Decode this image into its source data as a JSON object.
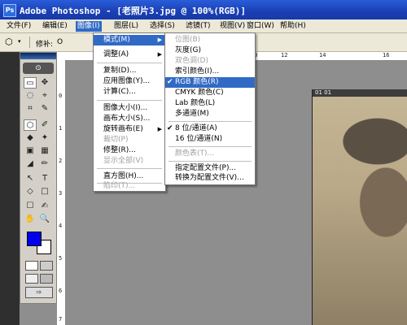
{
  "window": {
    "title": "Adobe Photoshop - [老照片3.jpg @ 100%(RGB)]",
    "logo": "Ps"
  },
  "menubar": {
    "items": [
      "文件(F)",
      "编辑(E)",
      "图像(I)",
      "图层(L)",
      "选择(S)",
      "滤镜(T)",
      "视图(V)",
      "窗口(W)",
      "帮助(H)"
    ]
  },
  "options": {
    "feather_label": "修补:",
    "radio_label": "O"
  },
  "ruler": {
    "h_labels": [
      "10",
      "12",
      "14",
      "16"
    ],
    "v_labels": [
      "0",
      "1",
      "2",
      "3",
      "4",
      "5",
      "6",
      "7"
    ]
  },
  "document": {
    "tab": "01 01"
  },
  "image_menu": {
    "items": [
      {
        "label": "模式(M)",
        "state": "highlight",
        "submenu": true
      },
      {
        "label": "调整(A)",
        "state": "normal",
        "submenu": true
      },
      {
        "label": "复制(D)...",
        "state": "normal"
      },
      {
        "label": "应用图像(Y)...",
        "state": "normal"
      },
      {
        "label": "计算(C)...",
        "state": "normal"
      },
      {
        "label": "图像大小(I)...",
        "state": "normal"
      },
      {
        "label": "画布大小(S)...",
        "state": "normal"
      },
      {
        "label": "旋转画布(E)",
        "state": "normal",
        "submenu": true
      },
      {
        "label": "裁切(P)",
        "state": "disabled"
      },
      {
        "label": "修整(R)...",
        "state": "normal"
      },
      {
        "label": "显示全部(V)",
        "state": "disabled"
      },
      {
        "label": "直方图(H)...",
        "state": "normal"
      },
      {
        "label": "陷印(T)...",
        "state": "disabled"
      }
    ]
  },
  "mode_menu": {
    "items": [
      {
        "label": "位图(B)",
        "state": "disabled"
      },
      {
        "label": "灰度(G)",
        "state": "normal"
      },
      {
        "label": "双色调(D)",
        "state": "disabled"
      },
      {
        "label": "索引颜色(I)...",
        "state": "normal"
      },
      {
        "label": "RGB 颜色(R)",
        "state": "highlight",
        "checked": true
      },
      {
        "label": "CMYK 颜色(C)",
        "state": "normal"
      },
      {
        "label": "Lab 颜色(L)",
        "state": "normal"
      },
      {
        "label": "多通道(M)",
        "state": "normal"
      },
      {
        "label": "8 位/通道(A)",
        "state": "normal",
        "checked": true
      },
      {
        "label": "16 位/通道(N)",
        "state": "normal"
      },
      {
        "label": "颜色表(T)...",
        "state": "disabled"
      },
      {
        "label": "指定配置文件(P)...",
        "state": "normal"
      },
      {
        "label": "转换为配置文件(V)...",
        "state": "normal"
      }
    ]
  },
  "toolbox": {
    "tools": [
      "▭",
      "✥",
      "◌",
      "⌖",
      "⌗",
      "✎",
      "⬡",
      "✐",
      "◆",
      "✦",
      "▣",
      "▦",
      "◢",
      "✏",
      "↖",
      "T",
      "◇",
      "□",
      "☐",
      "✍",
      "✋",
      "🔍"
    ],
    "fg_color": "#0000ee",
    "bg_color": "#ffffff"
  },
  "colors": {
    "highlight": "#316ac5",
    "title": "#1a3fb3"
  }
}
